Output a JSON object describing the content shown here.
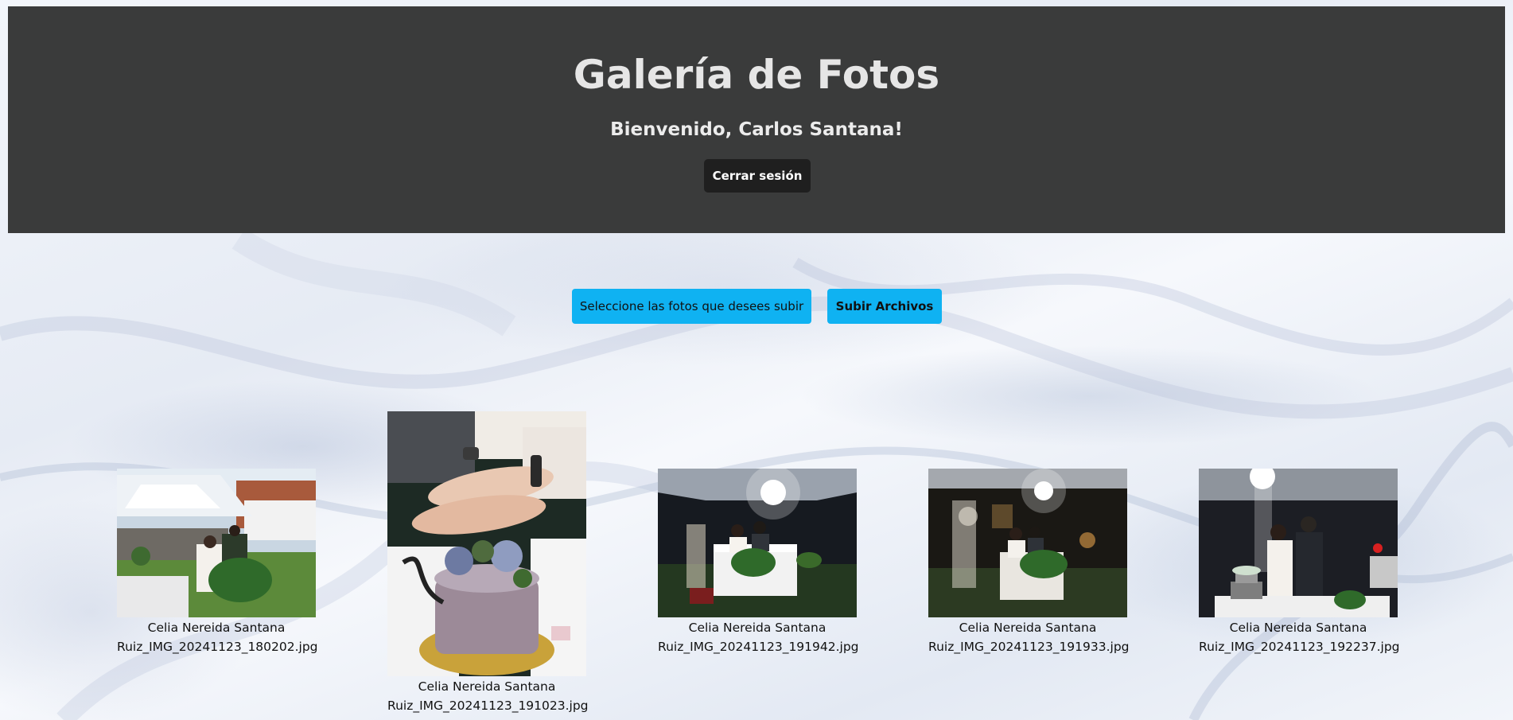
{
  "header": {
    "title": "Galería de Fotos",
    "welcome": "Bienvenido, Carlos Santana!",
    "logout_label": "Cerrar sesión"
  },
  "upload": {
    "select_label": "Seleccione las fotos que desees subir",
    "submit_label": "Subir Archivos"
  },
  "gallery": [
    {
      "caption_line1": "Celia Nereida Santana",
      "caption_line2": "Ruiz_IMG_20241123_180202.jpg"
    },
    {
      "caption_line1": "Celia Nereida Santana",
      "caption_line2": "Ruiz_IMG_20241123_191023.jpg"
    },
    {
      "caption_line1": "Celia Nereida Santana",
      "caption_line2": "Ruiz_IMG_20241123_191942.jpg"
    },
    {
      "caption_line1": "Celia Nereida Santana",
      "caption_line2": "Ruiz_IMG_20241123_191933.jpg"
    },
    {
      "caption_line1": "Celia Nereida Santana",
      "caption_line2": "Ruiz_IMG_20241123_192237.jpg"
    }
  ],
  "colors": {
    "header_bg": "#3a3b3b",
    "accent": "#0fb2f2",
    "logout_bg": "#1f1f1f"
  }
}
